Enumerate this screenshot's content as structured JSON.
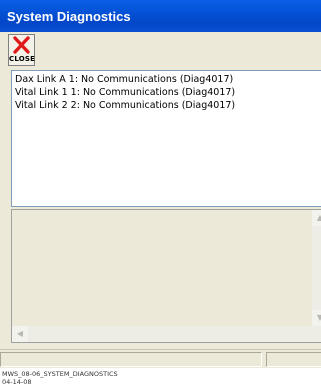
{
  "window": {
    "title": "System Diagnostics"
  },
  "toolbar": {
    "close_label": "CLOSE",
    "close_icon": "red-x-icon"
  },
  "diagnostics": {
    "items": [
      "Dax Link A 1: No Communications (Diag4017)",
      "Vital Link 1 1: No Communications (Diag4017)",
      "Vital Link 2 2: No Communications (Diag4017)"
    ]
  },
  "caption": {
    "line1": "MWS_08-06_SYSTEM_DIAGNOSTICS",
    "line2": "04-14-08"
  },
  "colors": {
    "titlebar": "#0553d8",
    "close_icon": "#e01a1a",
    "window_bg": "#ece9d8"
  }
}
